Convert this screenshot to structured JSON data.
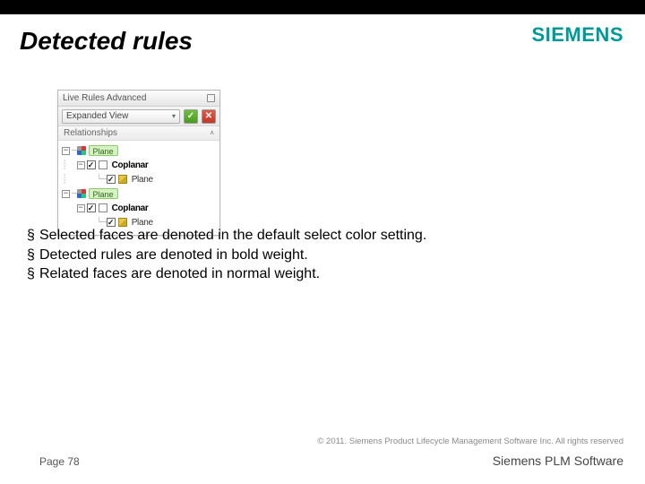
{
  "brand": "SIEMENS",
  "title": "Detected rules",
  "panel": {
    "caption": "Live Rules Advanced",
    "dropdown": "Expanded View",
    "section": "Relationships",
    "nodes": {
      "n0_tag": "Plane",
      "n0_0_label": "Coplanar",
      "n0_1_label": "Plane",
      "n1_tag": "Plane",
      "n1_0_label": "Coplanar",
      "n1_1_label": "Plane"
    }
  },
  "bullets": [
    "Selected faces are denoted in the default select color setting.",
    "Detected rules are denoted in bold weight.",
    "Related faces are denoted in normal weight."
  ],
  "footer": {
    "copyright": "© 2011. Siemens Product Lifecycle Management Software Inc. All rights reserved",
    "page": "Page 78",
    "product": "Siemens PLM Software"
  }
}
